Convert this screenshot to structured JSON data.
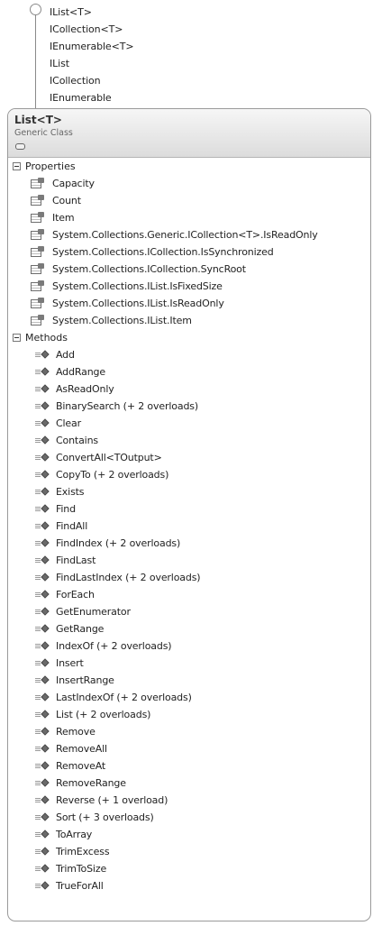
{
  "interfaces": [
    "IList<T>",
    "ICollection<T>",
    "IEnumerable<T>",
    "IList",
    "ICollection",
    "IEnumerable"
  ],
  "class_shape": {
    "title": "List<T>",
    "subtitle": "Generic Class"
  },
  "sections": {
    "properties_label": "Properties",
    "methods_label": "Methods"
  },
  "properties": [
    "Capacity",
    "Count",
    "Item",
    "System.Collections.Generic.ICollection<T>.IsReadOnly",
    "System.Collections.ICollection.IsSynchronized",
    "System.Collections.ICollection.SyncRoot",
    "System.Collections.IList.IsFixedSize",
    "System.Collections.IList.IsReadOnly",
    "System.Collections.IList.Item"
  ],
  "methods": [
    "Add",
    "AddRange",
    "AsReadOnly",
    "BinarySearch (+ 2 overloads)",
    "Clear",
    "Contains",
    "ConvertAll<TOutput>",
    "CopyTo (+ 2 overloads)",
    "Exists",
    "Find",
    "FindAll",
    "FindIndex (+ 2 overloads)",
    "FindLast",
    "FindLastIndex (+ 2 overloads)",
    "ForEach",
    "GetEnumerator",
    "GetRange",
    "IndexOf (+ 2 overloads)",
    "Insert",
    "InsertRange",
    "LastIndexOf (+ 2 overloads)",
    "List (+ 2 overloads)",
    "Remove",
    "RemoveAll",
    "RemoveAt",
    "RemoveRange",
    "Reverse (+ 1 overload)",
    "Sort (+ 3 overloads)",
    "ToArray",
    "TrimExcess",
    "TrimToSize",
    "TrueForAll"
  ],
  "icons": {
    "interface": "interface-lollipop-icon",
    "collapse": "collapse-toggle-icon",
    "section": "minus-expander-icon",
    "property": "property-icon",
    "method": "method-icon"
  }
}
